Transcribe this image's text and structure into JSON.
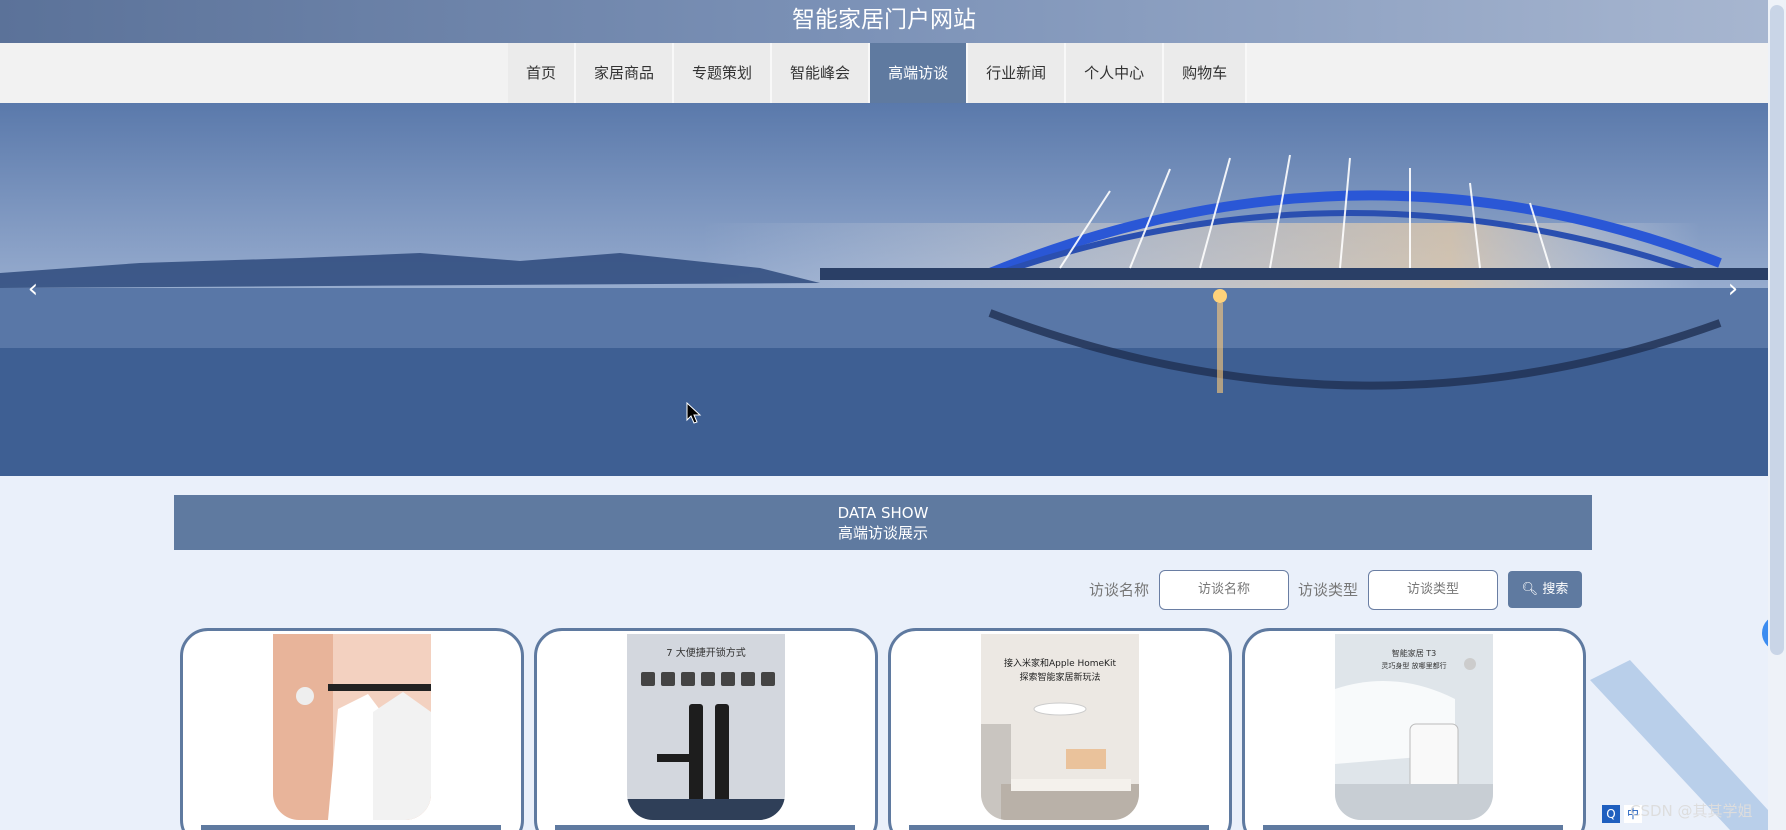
{
  "site": {
    "title": "智能家居门户网站"
  },
  "nav": {
    "items": [
      {
        "label": "首页",
        "active": false
      },
      {
        "label": "家居商品",
        "active": false
      },
      {
        "label": "专题策划",
        "active": false
      },
      {
        "label": "智能峰会",
        "active": false
      },
      {
        "label": "高端访谈",
        "active": true
      },
      {
        "label": "行业新闻",
        "active": false
      },
      {
        "label": "个人中心",
        "active": false
      },
      {
        "label": "购物车",
        "active": false
      }
    ]
  },
  "section": {
    "en": "DATA SHOW",
    "cn": "高端访谈展示"
  },
  "search": {
    "name_label": "访谈名称",
    "name_placeholder": "访谈名称",
    "type_label": "访谈类型",
    "type_placeholder": "访谈类型",
    "button_label": "搜索"
  },
  "cards": [
    {
      "id": "1"
    },
    {
      "id": "2",
      "text1": "7 大便捷开锁方式"
    },
    {
      "id": "3",
      "text1": "接入米家和Apple HomeKit",
      "text2": "探索智能家居新玩法"
    },
    {
      "id": "4",
      "text1": "智能家居 T3",
      "text2": "灵巧身型 放哪里都行"
    }
  ],
  "watermark": "CSDN @其其学姐",
  "tray": {
    "items": [
      "Q",
      "中"
    ]
  },
  "colors": {
    "accent": "#5f7aa0",
    "header_start": "#5b7299",
    "page_bg": "#eaf0fa"
  }
}
